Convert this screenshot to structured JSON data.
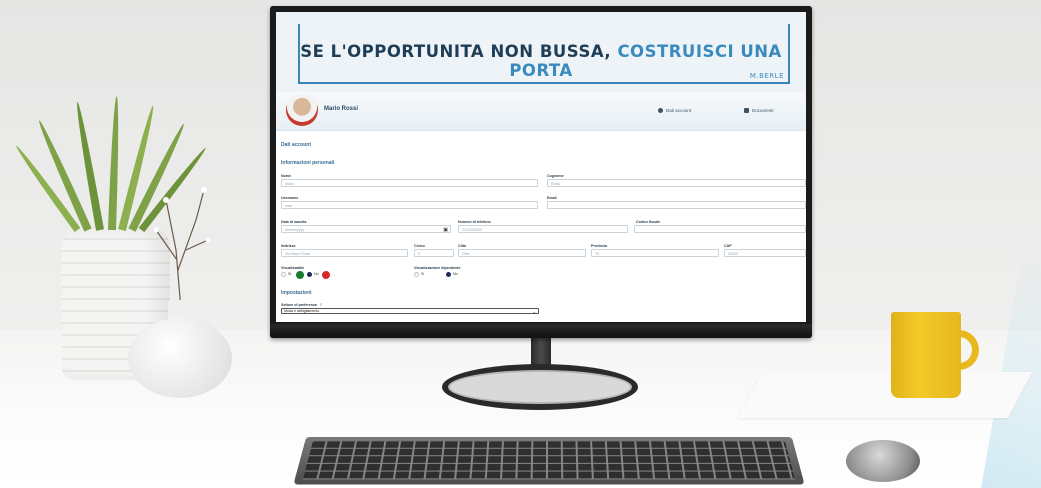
{
  "banner": {
    "quote_main": "SE L'OPPORTUNITA NON BUSSA,",
    "quote_accent": "COSTRUISCI UNA PORTA",
    "author": "M.BERLE"
  },
  "profile": {
    "username": "Mario Rossi",
    "nav": [
      {
        "label": "Dati account",
        "icon": "user-icon"
      },
      {
        "label": "Documenti",
        "icon": "document-icon"
      }
    ]
  },
  "form": {
    "section_account": "Dati account",
    "section_personal": "Informazioni personali",
    "fields": {
      "nome": {
        "label": "Nome",
        "placeholder": "Mario"
      },
      "cognome": {
        "label": "Cognome",
        "placeholder": "Rossi"
      },
      "username": {
        "label": "Username",
        "placeholder": "mari"
      },
      "email": {
        "label": "Email",
        "placeholder": ""
      },
      "data_nascita": {
        "label": "Data di nascita",
        "placeholder": "dd/mm/yyyy"
      },
      "telefono": {
        "label": "Numero di telefono",
        "placeholder": "3470000000"
      },
      "codice_fiscale": {
        "label": "Codice fiscale",
        "placeholder": ""
      },
      "indirizzo": {
        "label": "Indirizzo",
        "placeholder": "Via Mario Rossi"
      },
      "civico": {
        "label": "Civico",
        "placeholder": "0"
      },
      "citta": {
        "label": "Città",
        "placeholder": "Città"
      },
      "provincia": {
        "label": "Provincia",
        "placeholder": "TE"
      },
      "cap": {
        "label": "CAP",
        "placeholder": "00000"
      }
    },
    "visualizzabile": {
      "label": "Visualizzabile",
      "options": [
        "Sì",
        "No"
      ],
      "selected": "No"
    },
    "visualizzazione_dipendente": {
      "label": "Visualizzazione dipendente",
      "options": [
        "Sì",
        "No"
      ],
      "selected": "No"
    },
    "section_settings": "Impostazioni",
    "settore": {
      "label": "Settore di preferenza",
      "help": "?",
      "value": "Moda e abbigliamento"
    }
  },
  "colors": {
    "accent": "#3a8bbd",
    "dark_blue": "#1e3e57",
    "green_status": "#1a7a2e",
    "red_status": "#d62828"
  }
}
